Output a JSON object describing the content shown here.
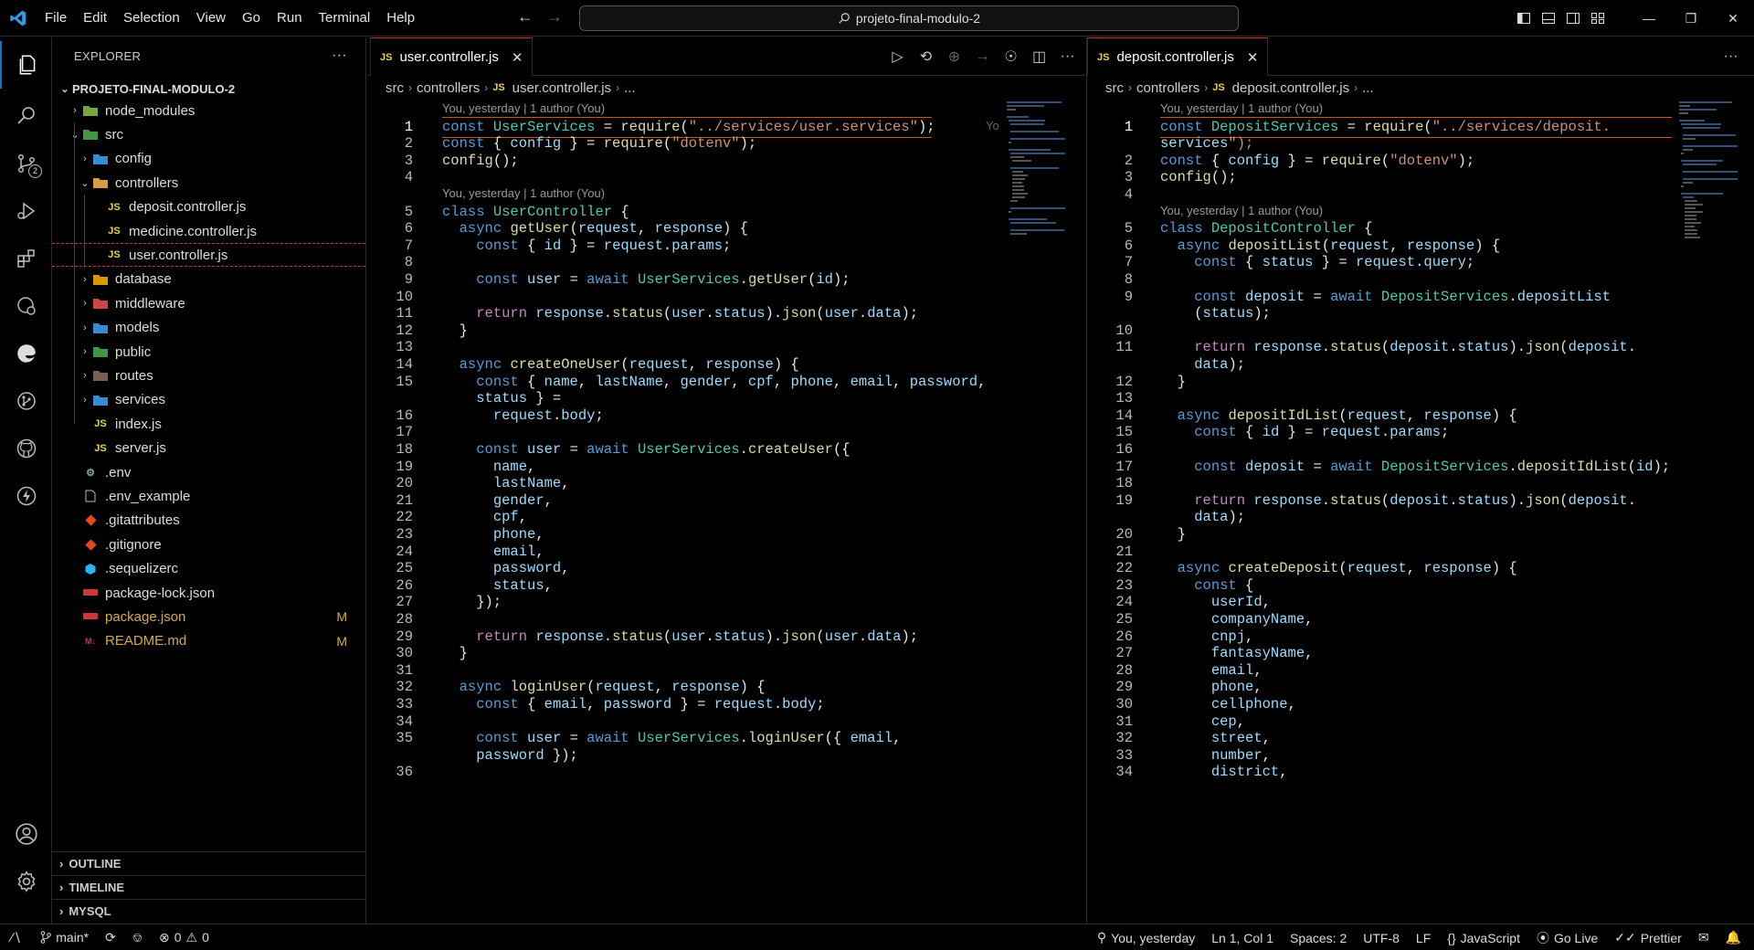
{
  "titlebar": {
    "menu": [
      "File",
      "Edit",
      "Selection",
      "View",
      "Go",
      "Run",
      "Terminal",
      "Help"
    ],
    "search": "projeto-final-modulo-2"
  },
  "activity": {
    "scm_badge": "2"
  },
  "sidebar": {
    "title": "EXPLORER",
    "more": "···",
    "root": "PROJETO-FINAL-MODULO-2",
    "tree": [
      {
        "label": "node_modules",
        "depth": 1,
        "chev": "›",
        "icon": "folder-node-icon",
        "color": "#8bc34a"
      },
      {
        "label": "src",
        "depth": 1,
        "chev": "⌄",
        "icon": "folder-src-icon",
        "color": "#4caf50"
      },
      {
        "label": "config",
        "depth": 2,
        "chev": "›",
        "icon": "folder-config-icon",
        "color": "#42a5f5"
      },
      {
        "label": "controllers",
        "depth": 2,
        "chev": "⌄",
        "icon": "folder-controllers-icon",
        "color": "#ffb74d"
      },
      {
        "label": "deposit.controller.js",
        "depth": 3,
        "chev": "",
        "icon": "js-icon",
        "color": "#e8d44d"
      },
      {
        "label": "medicine.controller.js",
        "depth": 3,
        "chev": "",
        "icon": "js-icon",
        "color": "#e8d44d"
      },
      {
        "label": "user.controller.js",
        "depth": 3,
        "chev": "",
        "icon": "js-icon",
        "color": "#e8d44d"
      },
      {
        "label": "database",
        "depth": 2,
        "chev": "›",
        "icon": "folder-database-icon",
        "color": "#ffb300"
      },
      {
        "label": "middleware",
        "depth": 2,
        "chev": "›",
        "icon": "folder-middleware-icon",
        "color": "#ef5350"
      },
      {
        "label": "models",
        "depth": 2,
        "chev": "›",
        "icon": "folder-models-icon",
        "color": "#42a5f5"
      },
      {
        "label": "public",
        "depth": 2,
        "chev": "›",
        "icon": "folder-public-icon",
        "color": "#4caf50"
      },
      {
        "label": "routes",
        "depth": 2,
        "chev": "›",
        "icon": "folder-routes-icon",
        "color": "#8d6e63"
      },
      {
        "label": "services",
        "depth": 2,
        "chev": "›",
        "icon": "folder-services-icon",
        "color": "#42a5f5"
      },
      {
        "label": "index.js",
        "depth": 2,
        "chev": "",
        "icon": "js-icon",
        "color": "#e8d44d"
      },
      {
        "label": "server.js",
        "depth": 2,
        "chev": "",
        "icon": "js-icon",
        "color": "#e8d44d"
      },
      {
        "label": ".env",
        "depth": 1,
        "chev": "",
        "icon": "gear-icon",
        "color": "#90a4ae"
      },
      {
        "label": ".env_example",
        "depth": 1,
        "chev": "",
        "icon": "file-icon",
        "color": "#bbbbbb"
      },
      {
        "label": ".gitattributes",
        "depth": 1,
        "chev": "",
        "icon": "git-icon",
        "color": "#e64a19"
      },
      {
        "label": ".gitignore",
        "depth": 1,
        "chev": "",
        "icon": "git-icon",
        "color": "#e64a19"
      },
      {
        "label": ".sequelizerc",
        "depth": 1,
        "chev": "",
        "icon": "sequelize-icon",
        "color": "#29b6f6"
      },
      {
        "label": "package-lock.json",
        "depth": 1,
        "chev": "",
        "icon": "npm-icon",
        "color": "#cb3837"
      },
      {
        "label": "package.json",
        "depth": 1,
        "chev": "",
        "icon": "npm-icon",
        "color": "#cb3837",
        "badge": "M"
      },
      {
        "label": "README.md",
        "depth": 1,
        "chev": "",
        "icon": "markdown-icon",
        "color": "#cb3837",
        "badge": "M"
      }
    ],
    "sections": [
      "OUTLINE",
      "TIMELINE",
      "MYSQL"
    ]
  },
  "editor_left": {
    "tab": "user.controller.js",
    "breadcrumb": [
      "src",
      "controllers",
      "user.controller.js",
      "..."
    ],
    "lens1": "You, yesterday | 1 author (You)",
    "lens2": "You, yesterday | 1 author (You)",
    "inline_blame": "Yo",
    "lines": [
      {
        "n": "1",
        "t": "const UserServices = require(\"../services/user.services\");"
      },
      {
        "n": "2",
        "t": "const { config } = require(\"dotenv\");"
      },
      {
        "n": "3",
        "t": "config();"
      },
      {
        "n": "4",
        "t": ""
      },
      {
        "n": "5",
        "t": "class UserController {"
      },
      {
        "n": "6",
        "t": "  async getUser(request, response) {"
      },
      {
        "n": "7",
        "t": "    const { id } = request.params;"
      },
      {
        "n": "8",
        "t": ""
      },
      {
        "n": "9",
        "t": "    const user = await UserServices.getUser(id);"
      },
      {
        "n": "10",
        "t": ""
      },
      {
        "n": "11",
        "t": "    return response.status(user.status).json(user.data);"
      },
      {
        "n": "12",
        "t": "  }"
      },
      {
        "n": "13",
        "t": ""
      },
      {
        "n": "14",
        "t": "  async createOneUser(request, response) {"
      },
      {
        "n": "15",
        "t": "    const { name, lastName, gender, cpf, phone, email, password,"
      },
      {
        "n": "",
        "t": "    status } ="
      },
      {
        "n": "16",
        "t": "      request.body;"
      },
      {
        "n": "17",
        "t": ""
      },
      {
        "n": "18",
        "t": "    const user = await UserServices.createUser({"
      },
      {
        "n": "19",
        "t": "      name,"
      },
      {
        "n": "20",
        "t": "      lastName,"
      },
      {
        "n": "21",
        "t": "      gender,"
      },
      {
        "n": "22",
        "t": "      cpf,"
      },
      {
        "n": "23",
        "t": "      phone,"
      },
      {
        "n": "24",
        "t": "      email,"
      },
      {
        "n": "25",
        "t": "      password,"
      },
      {
        "n": "26",
        "t": "      status,"
      },
      {
        "n": "27",
        "t": "    });"
      },
      {
        "n": "28",
        "t": ""
      },
      {
        "n": "29",
        "t": "    return response.status(user.status).json(user.data);"
      },
      {
        "n": "30",
        "t": "  }"
      },
      {
        "n": "31",
        "t": ""
      },
      {
        "n": "32",
        "t": "  async loginUser(request, response) {"
      },
      {
        "n": "33",
        "t": "    const { email, password } = request.body;"
      },
      {
        "n": "34",
        "t": ""
      },
      {
        "n": "35",
        "t": "    const user = await UserServices.loginUser({ email,"
      },
      {
        "n": "",
        "t": "    password });"
      },
      {
        "n": "36",
        "t": ""
      }
    ]
  },
  "editor_right": {
    "tab": "deposit.controller.js",
    "breadcrumb": [
      "src",
      "controllers",
      "deposit.controller.js",
      "..."
    ],
    "lens1": "You, yesterday | 1 author (You)",
    "lens2": "You, yesterday | 1 author (You)",
    "lines": [
      {
        "n": "1",
        "t": "const DepositServices = require(\"../services/deposit."
      },
      {
        "n": "",
        "t": "services\");"
      },
      {
        "n": "2",
        "t": "const { config } = require(\"dotenv\");"
      },
      {
        "n": "3",
        "t": "config();"
      },
      {
        "n": "4",
        "t": ""
      },
      {
        "n": "5",
        "t": "class DepositController {"
      },
      {
        "n": "6",
        "t": "  async depositList(request, response) {"
      },
      {
        "n": "7",
        "t": "    const { status } = request.query;"
      },
      {
        "n": "8",
        "t": ""
      },
      {
        "n": "9",
        "t": "    const deposit = await DepositServices.depositList"
      },
      {
        "n": "",
        "t": "    (status);"
      },
      {
        "n": "10",
        "t": ""
      },
      {
        "n": "11",
        "t": "    return response.status(deposit.status).json(deposit."
      },
      {
        "n": "",
        "t": "    data);"
      },
      {
        "n": "12",
        "t": "  }"
      },
      {
        "n": "13",
        "t": ""
      },
      {
        "n": "14",
        "t": "  async depositIdList(request, response) {"
      },
      {
        "n": "15",
        "t": "    const { id } = request.params;"
      },
      {
        "n": "16",
        "t": ""
      },
      {
        "n": "17",
        "t": "    const deposit = await DepositServices.depositIdList(id);"
      },
      {
        "n": "18",
        "t": ""
      },
      {
        "n": "19",
        "t": "    return response.status(deposit.status).json(deposit."
      },
      {
        "n": "",
        "t": "    data);"
      },
      {
        "n": "20",
        "t": "  }"
      },
      {
        "n": "21",
        "t": ""
      },
      {
        "n": "22",
        "t": "  async createDeposit(request, response) {"
      },
      {
        "n": "23",
        "t": "    const {"
      },
      {
        "n": "24",
        "t": "      userId,"
      },
      {
        "n": "25",
        "t": "      companyName,"
      },
      {
        "n": "26",
        "t": "      cnpj,"
      },
      {
        "n": "27",
        "t": "      fantasyName,"
      },
      {
        "n": "28",
        "t": "      email,"
      },
      {
        "n": "29",
        "t": "      phone,"
      },
      {
        "n": "30",
        "t": "      cellphone,"
      },
      {
        "n": "31",
        "t": "      cep,"
      },
      {
        "n": "32",
        "t": "      street,"
      },
      {
        "n": "33",
        "t": "      number,"
      },
      {
        "n": "34",
        "t": "      district,"
      }
    ]
  },
  "statusbar": {
    "branch": "main*",
    "errors": "0",
    "warnings": "0",
    "blame": "You, yesterday",
    "position": "Ln 1, Col 1",
    "spaces": "Spaces: 2",
    "encoding": "UTF-8",
    "eol": "LF",
    "language": "JavaScript",
    "golive": "Go Live",
    "prettier": "Prettier"
  },
  "colors": {
    "accent": "#0078d4",
    "cursor_line": "#c65a1b",
    "selection_border": "#cc3333",
    "modified": "#d7a84b"
  }
}
